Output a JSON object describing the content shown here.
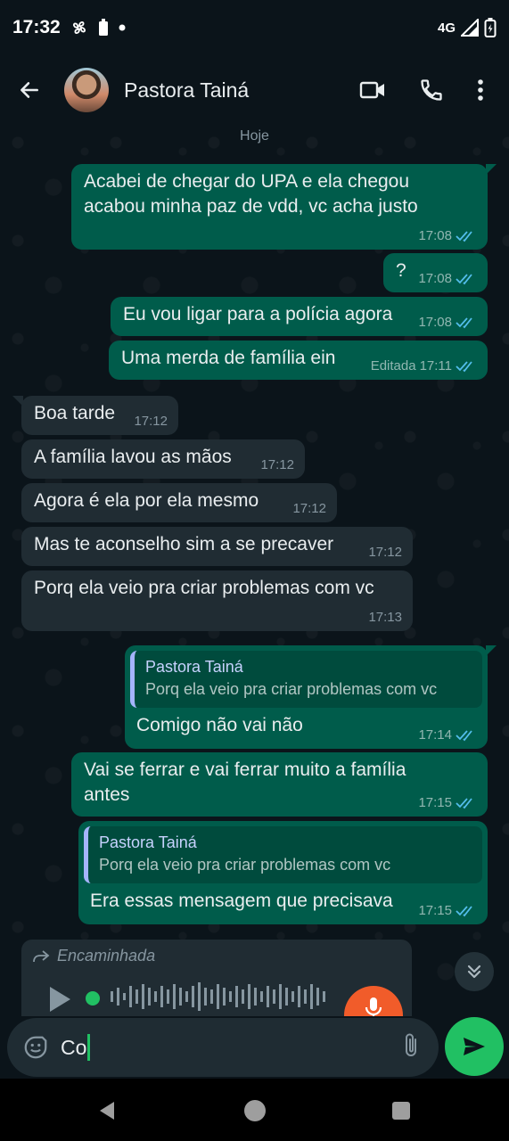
{
  "status_bar": {
    "time": "17:32",
    "network": "4G"
  },
  "header": {
    "contact_name": "Pastora Tainá"
  },
  "date_separator": "Hoje",
  "messages": [
    {
      "dir": "out",
      "text": "Acabei de chegar do UPA e ela chegou acabou minha paz de vdd, vc acha justo",
      "time": "17:08",
      "edited": ""
    },
    {
      "dir": "out",
      "text": "?",
      "time": "17:08",
      "edited": ""
    },
    {
      "dir": "out",
      "text": "Eu vou ligar para a polícia agora",
      "time": "17:08",
      "edited": ""
    },
    {
      "dir": "out",
      "text": "Uma merda de família ein",
      "time": "17:11",
      "edited": "Editada"
    },
    {
      "dir": "in",
      "text": "Boa tarde",
      "time": "17:12"
    },
    {
      "dir": "in",
      "text": "A família lavou as mãos",
      "time": "17:12"
    },
    {
      "dir": "in",
      "text": "Agora é ela por ela mesmo",
      "time": "17:12"
    },
    {
      "dir": "in",
      "text": "Mas te aconselho sim a se precaver",
      "time": "17:12"
    },
    {
      "dir": "in",
      "text": "Porq ela veio pra criar problemas com vc",
      "time": "17:13"
    },
    {
      "dir": "out",
      "quote_name": "Pastora Tainá",
      "quote_text": "Porq ela veio pra criar problemas com vc",
      "text": "Comigo não vai não",
      "time": "17:14"
    },
    {
      "dir": "out",
      "text": "Vai se ferrar e vai ferrar muito a família antes",
      "time": "17:15"
    },
    {
      "dir": "out",
      "quote_name": "Pastora Tainá",
      "quote_text": "Porq ela veio pra criar problemas com vc",
      "text": "Era essas mensagem que precisava",
      "time": "17:15"
    }
  ],
  "forwarded_audio": {
    "label": "Encaminhada"
  },
  "composer": {
    "text": "Co"
  },
  "colors": {
    "outgoing_bubble": "#005c4b",
    "incoming_bubble": "#202c33",
    "accent_green": "#21c063",
    "read_ticks": "#53bdeb",
    "record_button": "#f15c2a"
  }
}
